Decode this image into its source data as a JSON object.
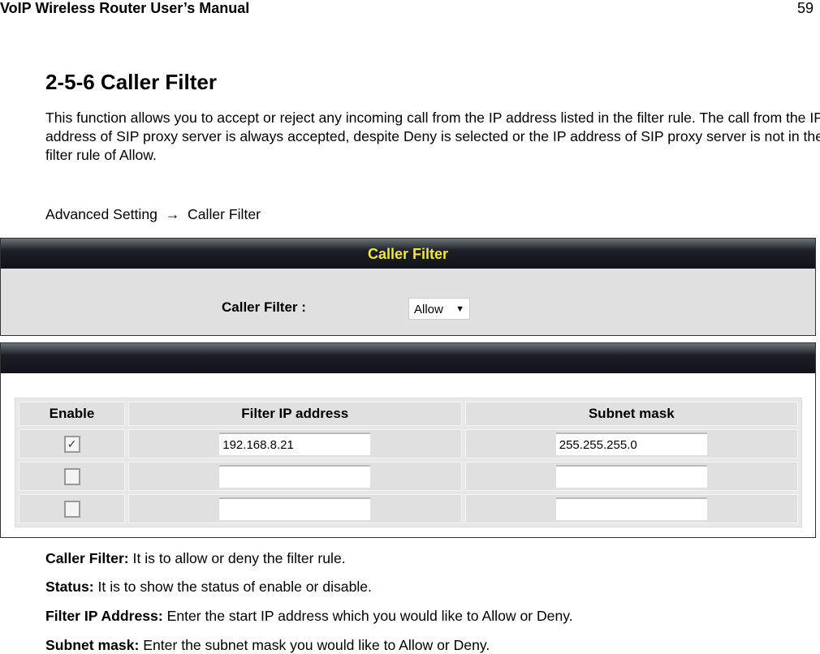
{
  "header": {
    "title": "VoIP Wireless Router User’s Manual",
    "page": "59"
  },
  "section": {
    "title": "2-5-6 Caller Filter",
    "intro": "This function allows you to accept or reject any incoming call from the IP address listed in the filter rule. The call from the IP address of SIP proxy server is always accepted, despite Deny is selected or the IP address of SIP proxy server is not in the filter rule of Allow.",
    "breadcrumb": "Advanced Setting  →  Caller Filter"
  },
  "ui": {
    "panel_title": "Caller Filter",
    "caller_filter_label": "Caller Filter :",
    "caller_filter_value": "Allow",
    "table": {
      "headers": [
        "Enable",
        "Filter IP address",
        "Subnet mask"
      ],
      "rows": [
        {
          "enabled": true,
          "ip": "192.168.8.21",
          "mask": "255.255.255.0"
        },
        {
          "enabled": false,
          "ip": "",
          "mask": ""
        },
        {
          "enabled": false,
          "ip": "",
          "mask": ""
        }
      ]
    }
  },
  "descriptions": [
    {
      "term": "Caller Filter:",
      "text": " It is to allow or deny the filter rule."
    },
    {
      "term": "Status:",
      "text": " It is to show the status of enable or disable."
    },
    {
      "term": "Filter IP Address:",
      "text": " Enter the start IP address which you would like to Allow or Deny."
    },
    {
      "term": "Subnet mask:",
      "text": " Enter the subnet mask you would like to Allow or Deny."
    }
  ]
}
